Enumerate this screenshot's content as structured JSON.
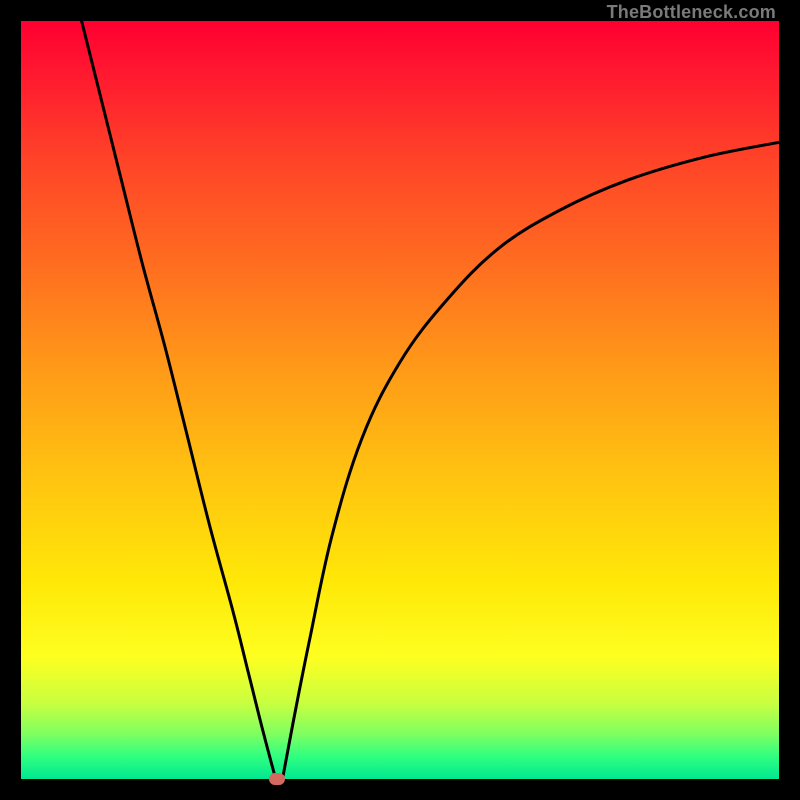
{
  "attribution": "TheBottleneck.com",
  "colors": {
    "frame": "#000000",
    "gradient_top": "#ff0030",
    "gradient_mid": "#ffe808",
    "gradient_bottom": "#00e890",
    "curve": "#000000",
    "marker": "#d46a5f"
  },
  "chart_data": {
    "type": "line",
    "title": "",
    "xlabel": "",
    "ylabel": "",
    "xlim": [
      0,
      100
    ],
    "ylim": [
      0,
      100
    ],
    "series": [
      {
        "name": "left-branch",
        "x": [
          8,
          10,
          13,
          16,
          19,
          22,
          25,
          28,
          30,
          32,
          33.6
        ],
        "values": [
          100,
          92,
          80,
          68,
          57,
          45,
          33,
          22,
          14,
          6,
          0
        ]
      },
      {
        "name": "right-branch",
        "x": [
          34.5,
          36,
          38,
          41,
          45,
          50,
          56,
          63,
          71,
          80,
          90,
          100
        ],
        "values": [
          0,
          8,
          18,
          32,
          45,
          55,
          63,
          70,
          75,
          79,
          82,
          84
        ]
      }
    ],
    "marker": {
      "x": 33.8,
      "y": 0,
      "shape": "rounded-rect"
    },
    "background_gradient": {
      "direction": "vertical",
      "stops": [
        {
          "pos": 0.0,
          "color": "#ff0030"
        },
        {
          "pos": 0.32,
          "color": "#ff6d20"
        },
        {
          "pos": 0.6,
          "color": "#ffc310"
        },
        {
          "pos": 0.84,
          "color": "#fdff20"
        },
        {
          "pos": 1.0,
          "color": "#00e890"
        }
      ]
    }
  }
}
